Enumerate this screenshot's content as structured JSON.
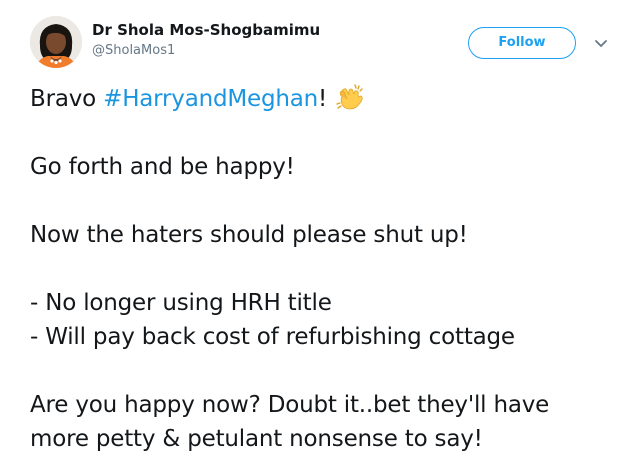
{
  "author": {
    "display_name": "Dr Shola Mos-Shogbamimu",
    "handle": "@SholaMos1",
    "avatar_icon": "profile-photo"
  },
  "actions": {
    "follow_label": "Follow",
    "menu_icon": "chevron-down-icon"
  },
  "tweet": {
    "line1_prefix": "Bravo ",
    "hashtag": "#HarryandMeghan",
    "line1_suffix": "!",
    "emoji": "clapping-hands-emoji",
    "line2": "Go forth and be happy!",
    "line3": "Now the haters should please shut up!",
    "line4": "- No longer using HRH title",
    "line5": "- Will pay back cost of refurbishing cottage",
    "line6": "Are you happy now? Doubt it..bet they'll have",
    "line7": "more petty & petulant nonsense to say!"
  },
  "colors": {
    "accent": "#1da1f2",
    "hashtag": "#1b95e0",
    "text": "#14171a",
    "muted": "#657786"
  }
}
